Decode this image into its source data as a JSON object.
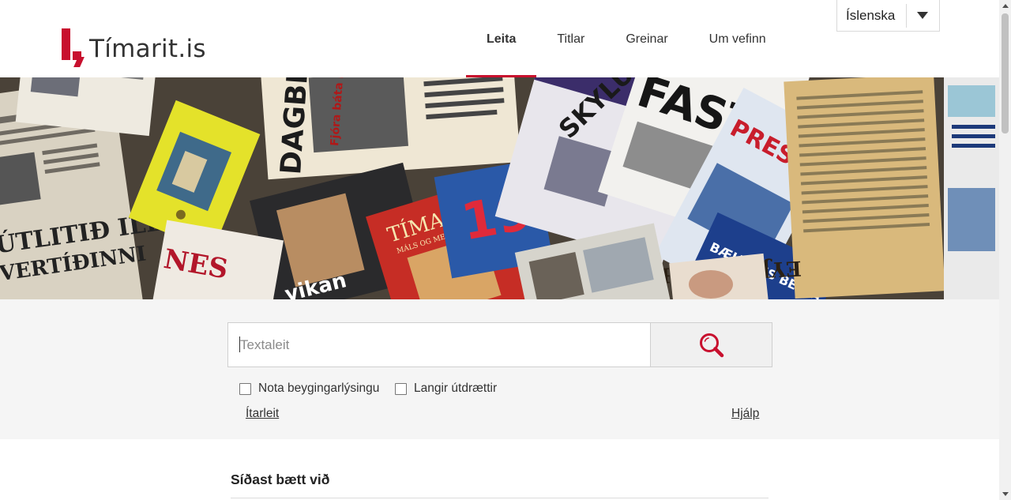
{
  "header": {
    "logo_text": "Tímarit.is",
    "nav": [
      {
        "label": "Leita",
        "active": true
      },
      {
        "label": "Titlar",
        "active": false
      },
      {
        "label": "Greinar",
        "active": false
      },
      {
        "label": "Um vefinn",
        "active": false
      }
    ],
    "language": {
      "selected": "Íslenska",
      "icon": "chevron-down-icon"
    }
  },
  "hero": {
    "description_icon": "newspaper-collage-image"
  },
  "search": {
    "placeholder": "Textaleit",
    "value": "",
    "button_icon": "search-icon",
    "options": [
      {
        "label": "Nota beygingarlýsingu",
        "checked": false
      },
      {
        "label": "Langir útdrættir",
        "checked": false
      }
    ],
    "advanced_link": "Ítarleit",
    "help_link": "Hjálp"
  },
  "recent": {
    "title": "Síðast bætt við"
  },
  "colors": {
    "accent": "#c8102e",
    "band_bg": "#f5f5f5",
    "text": "#333333"
  }
}
